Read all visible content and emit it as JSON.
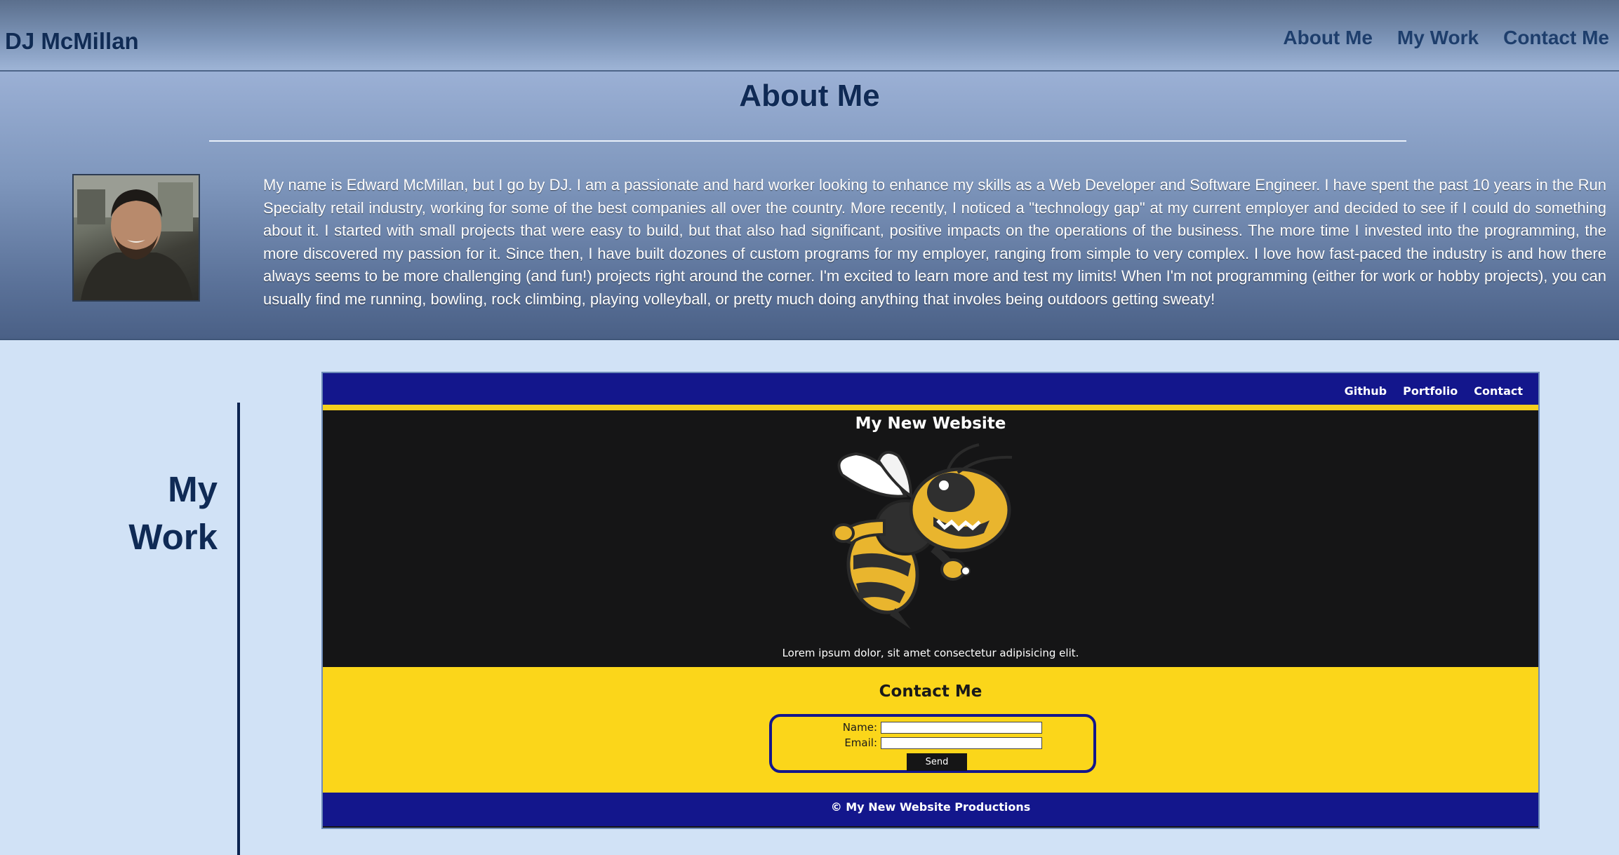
{
  "header": {
    "brand": "DJ McMillan",
    "nav": [
      "About Me",
      "My Work",
      "Contact Me"
    ]
  },
  "about": {
    "title": "About Me",
    "photo_alt": "Portrait photo of DJ McMillan",
    "bio": "My name is Edward McMillan, but I go by DJ. I am a passionate and hard worker looking to enhance my skills as a Web Developer and Software Engineer. I have spent the past 10 years in the Run Specialty retail industry, working for some of the best companies all over the country. More recently, I noticed a \"technology gap\" at my current employer and decided to see if I could do something about it. I started with small projects that were easy to build, but that also had significant, positive impacts on the operations of the business. The more time I invested into the programming, the more discovered my passion for it. Since then, I have built dozones of custom programs for my employer, ranging from simple to very complex. I love how fast-paced the industry is and how there always seems to be more challenging (and fun!) projects right around the corner. I'm excited to learn more and test my limits! When I'm not programming (either for work or hobby projects), you can usually find me running, bowling, rock climbing, playing volleyball, or pretty much doing anything that involes being outdoors getting sweaty!"
  },
  "work": {
    "title_line1": "My",
    "title_line2": "Work",
    "preview": {
      "nav": [
        "Github",
        "Portfolio",
        "Contact"
      ],
      "title": "My New Website",
      "mascot_icon": "yellow-jacket-mascot-icon",
      "lorem": "Lorem ipsum dolor, sit amet consectetur adipisicing elit.",
      "contact_title": "Contact Me",
      "name_label": "Name:",
      "email_label": "Email:",
      "send_label": "Send",
      "footer": "© My New Website Productions"
    }
  },
  "colors": {
    "page_bg": "#d1e2f6",
    "brand_navy": "#0f2a55",
    "preview_navy": "#13168c",
    "preview_yellow": "#fbd61a",
    "preview_dark": "#151516"
  }
}
